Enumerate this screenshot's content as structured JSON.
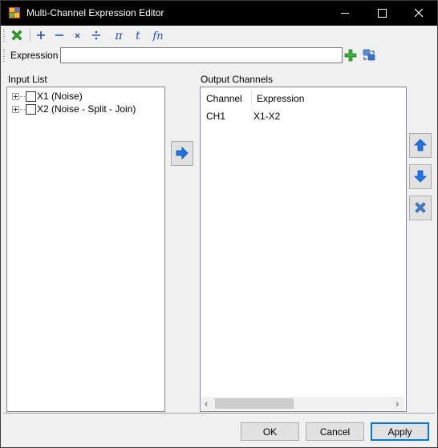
{
  "window": {
    "title": "Multi-Channel Expression Editor"
  },
  "titlebar_buttons": [
    "minimize-icon",
    "maximize-icon",
    "close-icon"
  ],
  "toolbar": {
    "tools": [
      {
        "name": "clear-icon",
        "glyph": "✖",
        "color": "#2e9e2e"
      },
      {
        "name": "plus-operator",
        "glyph": "+",
        "color": "#2050c0"
      },
      {
        "name": "minus-operator",
        "glyph": "−",
        "color": "#2050c0"
      },
      {
        "name": "multiply-operator",
        "glyph": "x",
        "color": "#2050c0"
      },
      {
        "name": "divide-operator",
        "glyph": "÷",
        "color": "#2050c0"
      },
      {
        "name": "pi-constant",
        "glyph": "π",
        "color": "#2050c0"
      },
      {
        "name": "time-variable",
        "glyph": "t",
        "color": "#2050c0"
      },
      {
        "name": "function-icon",
        "glyph": "fn",
        "color": "#2050c0"
      }
    ]
  },
  "expression_bar": {
    "label": "Expression",
    "value": "",
    "add_icon": "add-icon",
    "refresh_icon": "refresh-icon"
  },
  "input_list": {
    "title": "Input List",
    "items": [
      {
        "label": "X1 (Noise)"
      },
      {
        "label": "X2 (Noise - Split - Join)"
      }
    ]
  },
  "transfer_icon": "arrow-right-icon",
  "output_channels": {
    "title": "Output Channels",
    "columns": [
      "Channel",
      "Expression"
    ],
    "rows": [
      {
        "channel": "CH1",
        "expression": "X1-X2"
      }
    ],
    "scroll_left": "‹",
    "scroll_right": "›"
  },
  "side_buttons": [
    "move-up-icon",
    "move-down-icon",
    "delete-icon"
  ],
  "footer": {
    "ok": "OK",
    "cancel": "Cancel",
    "apply": "Apply"
  },
  "colors": {
    "titlebar_bg": "#000000",
    "window_bg": "#f0f0f0",
    "accent": "#0078d7",
    "arrow_blue": "#1e73e8",
    "add_green": "#2e9e2e"
  }
}
